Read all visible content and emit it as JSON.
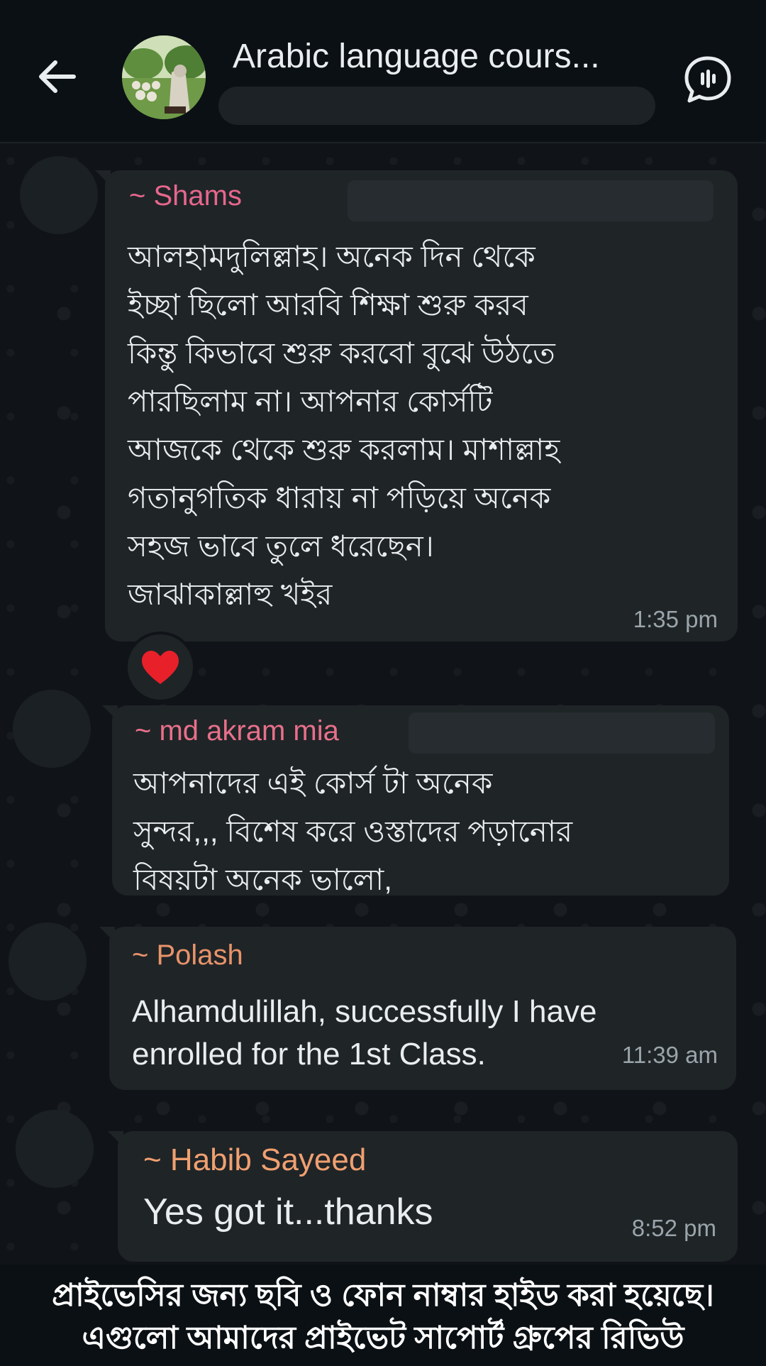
{
  "header": {
    "title": "Arabic language cours...",
    "back_icon": "arrow-left-icon",
    "voice_icon": "voice-chat-icon"
  },
  "messages": [
    {
      "sender": "~ Shams",
      "sender_color": "#e6678c",
      "lines": [
        "আলহামদুলিল্লাহ। অনেক দিন থেকে",
        "ইচ্ছা ছিলো আরবি শিক্ষা শুরু করব",
        "কিন্তু কিভাবে শুরু করবো বুঝে উঠতে",
        "পারছিলাম না। আপনার কোর্সটি",
        "আজকে থেকে শুরু করলাম। মাশাল্লাহ",
        "গতানুগতিক ধারায় না পড়িয়ে অনেক",
        "সহজ ভাবে তুলে ধরেছেন।",
        "জাঝাকাল্লাহু খইর"
      ],
      "time": "1:35 pm",
      "reaction": "❤️"
    },
    {
      "sender": "~ md akram mia",
      "sender_color": "#e8708a",
      "lines": [
        "আপনাদের এই কোর্স টা অনেক",
        "সুন্দর,,, বিশেষ করে ওস্তাদের পড়ানোর",
        "বিষয়টা অনেক ভালো,"
      ]
    },
    {
      "sender": "~ Polash",
      "sender_color": "#e8936a",
      "lines": [
        "Alhamdulillah, successfully I have",
        "enrolled for the 1st Class."
      ],
      "time": "11:39 am"
    },
    {
      "sender": "~ Habib Sayeed",
      "sender_color": "#f0a070",
      "lines": [
        "Yes got it...thanks"
      ],
      "time": "8:52 pm"
    }
  ],
  "footer": {
    "line1": "প্রাইভেসির জন্য ছবি ও ফোন নাম্বার হাইড করা হয়েছে।",
    "line2": "এগুলো আমাদের প্রাইভেট সাপোর্ট গ্রুপের রিভিউ"
  }
}
